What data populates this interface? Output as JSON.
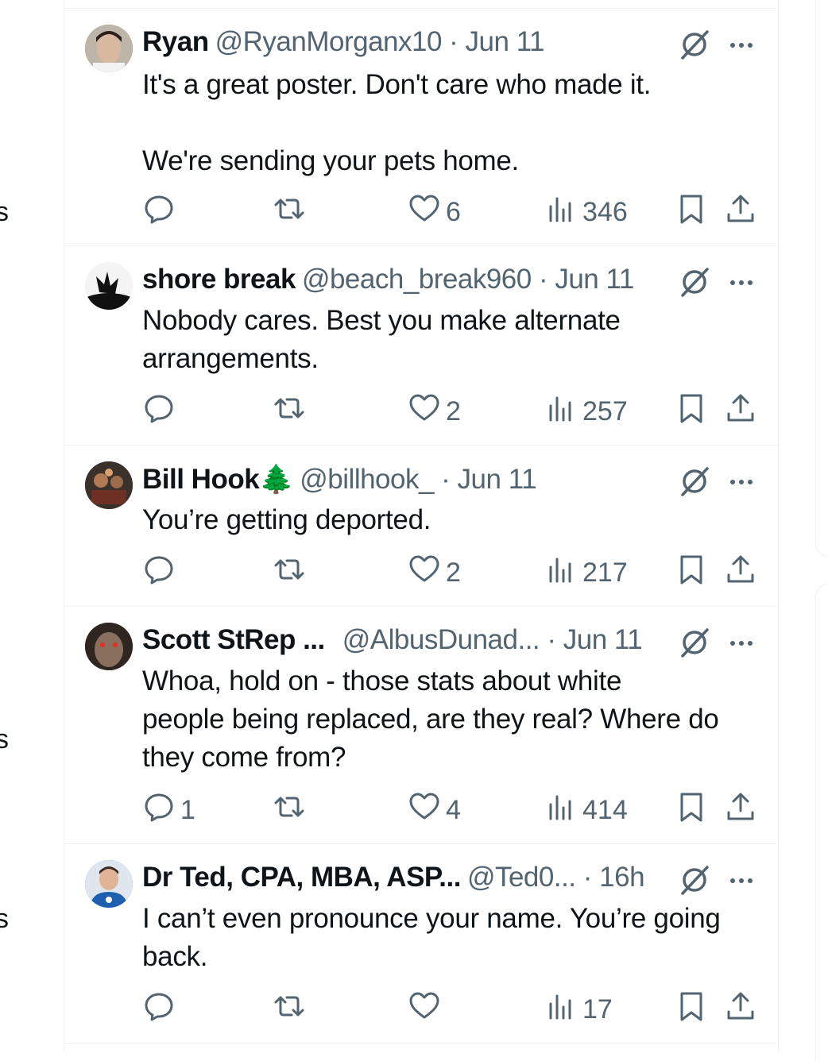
{
  "tweets": [
    {
      "display_name": "Ryan",
      "handle_date": "@RyanMorganx10 · Jun 11",
      "text": "It's a great poster. Don't care who made it.\n\nWe're sending your pets home.",
      "replies": "",
      "retweets": "",
      "likes": "6",
      "views": "346"
    },
    {
      "display_name": "shore break",
      "handle_date": "@beach_break960 · Jun 11",
      "text": "Nobody cares. Best you make alternate\narrangements.",
      "replies": "",
      "retweets": "",
      "likes": "2",
      "views": "257"
    },
    {
      "display_name": "Bill Hook🌲",
      "handle_date": "@billhook_ · Jun 11",
      "text": "You’re getting deported.",
      "replies": "",
      "retweets": "",
      "likes": "2",
      "views": "217"
    },
    {
      "display_name": "Scott StRep ...",
      "handle_date": "@AlbusDunad...  · Jun 11",
      "text": "Whoa, hold on - those stats about white\npeople being replaced, are they real? Where do\nthey come from?",
      "replies": "1",
      "retweets": "",
      "likes": "4",
      "views": "414"
    },
    {
      "display_name": "Dr Ted, CPA, MBA, ASP...",
      "handle_date": "@Ted0... · 16h",
      "text": "I can’t even pronounce your name. You’re going\nback.",
      "replies": "",
      "retweets": "",
      "likes": "",
      "views": "17"
    }
  ],
  "edge_glyphs": [
    "s",
    "s",
    "s"
  ],
  "icons": [
    "reply-icon",
    "retweet-icon",
    "like-icon",
    "views-icon",
    "bookmark-icon",
    "share-icon",
    "grok-icon",
    "more-icon"
  ],
  "colors": {
    "text": "#0f1419",
    "secondary": "#536471",
    "divider": "#eff3f4"
  }
}
